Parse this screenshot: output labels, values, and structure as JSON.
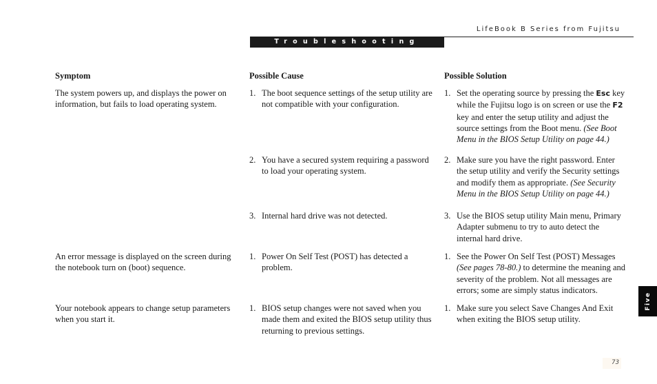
{
  "header": {
    "running_head": "LifeBook B Series from Fujitsu",
    "section_title": "Troubleshooting"
  },
  "columns": {
    "symptom": "Symptom",
    "cause": "Possible Cause",
    "solution": "Possible Solution"
  },
  "rows": [
    {
      "symptom": "The system powers up, and displays the power on information, but fails to load operating system.",
      "causes": [
        {
          "num": "1.",
          "text": "The boot sequence settings of the setup utility are not compatible with your configuration."
        },
        {
          "num": "2.",
          "text": "You have a secured system requiring a password to load your operating system."
        },
        {
          "num": "3.",
          "text": "Internal hard drive was not detected."
        }
      ],
      "solutions": [
        {
          "num": "1.",
          "pre": "Set the operating source by pressing the ",
          "key1": "Esc",
          "mid": " key while the Fujitsu logo is on screen or use the ",
          "key2": "F2",
          "post": " key and enter the setup utility and adjust the source settings from the Boot menu. ",
          "ref": "(See Boot Menu in the BIOS Setup Utility on page 44.)"
        },
        {
          "num": "2.",
          "pre": "Make sure you have the right password. Enter the setup utility and verify the Security settings and modify them as appropriate. ",
          "ref": "(See Security Menu in the BIOS Setup Utility on page 44.)"
        },
        {
          "num": "3.",
          "pre": "Use the BIOS setup utility Main menu, Primary Adapter submenu to try to auto detect the internal hard drive."
        }
      ]
    },
    {
      "symptom": "An error message is displayed on the screen during the notebook turn on (boot) sequence.",
      "causes": [
        {
          "num": "1.",
          "text": "Power On Self Test (POST) has detected a problem."
        }
      ],
      "solutions": [
        {
          "num": "1.",
          "pre": "See the Power On Self Test (POST) Messages ",
          "ref": "(See pages 78-80.)",
          "post": " to determine the meaning and severity of the problem. Not all messages are errors; some are simply status indicators."
        }
      ]
    },
    {
      "symptom": "Your notebook appears to change setup parameters when you start it.",
      "causes": [
        {
          "num": "1.",
          "text": "BIOS setup changes were not saved when you made them and exited the BIOS setup utility thus returning to previous settings."
        }
      ],
      "solutions": [
        {
          "num": "1.",
          "pre": "Make sure you select Save Changes And Exit when exiting the BIOS setup utility."
        }
      ]
    }
  ],
  "side_tab": "Five",
  "page_number": "73"
}
